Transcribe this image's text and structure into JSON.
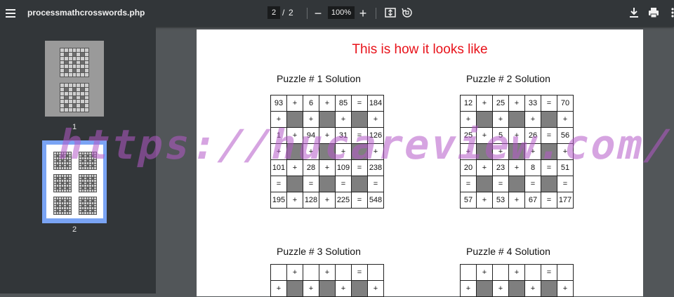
{
  "toolbar": {
    "title": "processmathcrosswords.php",
    "page_current": "2",
    "page_sep": "/",
    "page_total": "2",
    "zoom": "100%",
    "zoom_out_label": "−",
    "zoom_in_label": "+"
  },
  "sidebar": {
    "thumbs": [
      {
        "label": "1"
      },
      {
        "label": "2"
      }
    ]
  },
  "page": {
    "heading": "This is how it looks like",
    "puzzles": [
      {
        "title": "Puzzle # 1 Solution",
        "rows": [
          [
            "93",
            "+",
            "6",
            "+",
            "85",
            "=",
            "184"
          ],
          [
            "+",
            "#",
            "+",
            "#",
            "+",
            "#",
            "+"
          ],
          [
            "1",
            "+",
            "94",
            "+",
            "31",
            "=",
            "126"
          ],
          [
            "+",
            "#",
            "+",
            "#",
            "+",
            "#",
            "+"
          ],
          [
            "101",
            "+",
            "28",
            "+",
            "109",
            "=",
            "238"
          ],
          [
            "=",
            "#",
            "=",
            "#",
            "=",
            "#",
            "="
          ],
          [
            "195",
            "+",
            "128",
            "+",
            "225",
            "=",
            "548"
          ]
        ]
      },
      {
        "title": "Puzzle # 2 Solution",
        "rows": [
          [
            "12",
            "+",
            "25",
            "+",
            "33",
            "=",
            "70"
          ],
          [
            "+",
            "#",
            "+",
            "#",
            "+",
            "#",
            "+"
          ],
          [
            "25",
            "+",
            "5",
            "+",
            "26",
            "=",
            "56"
          ],
          [
            "+",
            "#",
            "+",
            "#",
            "+",
            "#",
            "+"
          ],
          [
            "20",
            "+",
            "23",
            "+",
            "8",
            "=",
            "51"
          ],
          [
            "=",
            "#",
            "=",
            "#",
            "=",
            "#",
            "="
          ],
          [
            "57",
            "+",
            "53",
            "+",
            "67",
            "=",
            "177"
          ]
        ]
      },
      {
        "title": "Puzzle # 3 Solution",
        "rows": [
          [
            "",
            "+",
            "",
            "+",
            "",
            "=",
            ""
          ],
          [
            "+",
            "#",
            "+",
            "#",
            "+",
            "#",
            "+"
          ]
        ]
      },
      {
        "title": "Puzzle # 4 Solution",
        "rows": [
          [
            "",
            "+",
            "",
            "+",
            "",
            "=",
            ""
          ],
          [
            "+",
            "#",
            "+",
            "#",
            "+",
            "#",
            "+"
          ]
        ]
      }
    ]
  },
  "watermark": "https://hucareview.com/"
}
